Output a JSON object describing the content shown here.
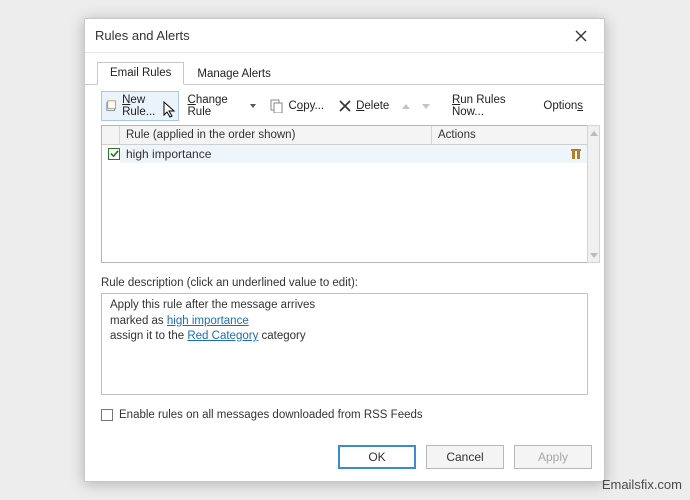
{
  "window": {
    "title": "Rules and Alerts"
  },
  "tabs": {
    "email_rules": "Email Rules",
    "manage_alerts": "Manage Alerts"
  },
  "toolbar": {
    "new_rule": "New Rule...",
    "change_rule": "Change Rule",
    "copy": "Copy...",
    "delete": "Delete",
    "run_rules": "Run Rules Now...",
    "options": "Options"
  },
  "rules_table": {
    "header_rule": "Rule (applied in the order shown)",
    "header_actions": "Actions",
    "rows": [
      {
        "checked": true,
        "name": "high importance"
      }
    ]
  },
  "description": {
    "label": "Rule description (click an underlined value to edit):",
    "line1": "Apply this rule after the message arrives",
    "line2_prefix": "marked as ",
    "line2_link": "high importance",
    "line3_prefix": "assign it to the ",
    "line3_link": "Red Category",
    "line3_suffix": " category"
  },
  "rss": {
    "label": "Enable rules on all messages downloaded from RSS Feeds"
  },
  "buttons": {
    "ok": "OK",
    "cancel": "Cancel",
    "apply": "Apply"
  },
  "watermark": "Emailsfix.com"
}
